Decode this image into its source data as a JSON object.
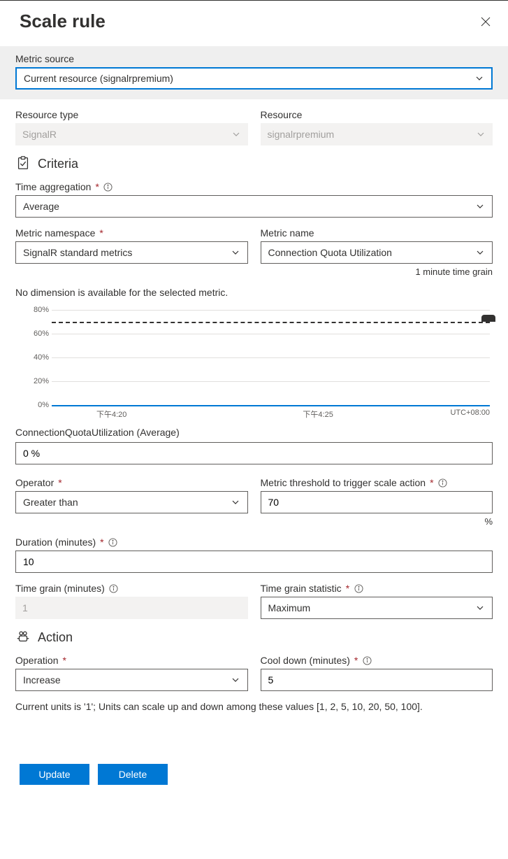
{
  "header": {
    "title": "Scale rule"
  },
  "metric_source": {
    "label": "Metric source",
    "value": "Current resource (signalrpremium)"
  },
  "resource_type": {
    "label": "Resource type",
    "value": "SignalR"
  },
  "resource": {
    "label": "Resource",
    "value": "signalrpremium"
  },
  "criteria": {
    "title": "Criteria",
    "time_aggregation": {
      "label": "Time aggregation",
      "value": "Average"
    },
    "metric_namespace": {
      "label": "Metric namespace",
      "value": "SignalR standard metrics"
    },
    "metric_name": {
      "label": "Metric name",
      "value": "Connection Quota Utilization",
      "time_grain_note": "1 minute time grain"
    },
    "no_dimension": "No dimension is available for the selected metric.",
    "chart_caption": "ConnectionQuotaUtilization (Average)",
    "chart_value": "0 %",
    "operator": {
      "label": "Operator",
      "value": "Greater than"
    },
    "threshold": {
      "label": "Metric threshold to trigger scale action",
      "value": "70",
      "unit": "%"
    },
    "duration": {
      "label": "Duration (minutes)",
      "value": "10"
    },
    "time_grain": {
      "label": "Time grain (minutes)",
      "value": "1"
    },
    "time_grain_stat": {
      "label": "Time grain statistic",
      "value": "Maximum"
    }
  },
  "action": {
    "title": "Action",
    "operation": {
      "label": "Operation",
      "value": "Increase"
    },
    "cool_down": {
      "label": "Cool down (minutes)",
      "value": "5"
    },
    "units_note": "Current units is '1'; Units can scale up and down among these values [1, 2, 5, 10, 20, 50, 100]."
  },
  "buttons": {
    "update": "Update",
    "delete": "Delete"
  },
  "chart_data": {
    "type": "line",
    "title": "ConnectionQuotaUtilization (Average)",
    "xlabel": "",
    "ylabel": "",
    "ylim": [
      0,
      80
    ],
    "yticks": [
      "0%",
      "20%",
      "40%",
      "60%",
      "80%"
    ],
    "xticks": [
      "下午4:20",
      "下午4:25"
    ],
    "timezone": "UTC+08:00",
    "threshold": 70,
    "series": [
      {
        "name": "ConnectionQuotaUtilization (Average)",
        "value_constant": 0
      }
    ]
  }
}
